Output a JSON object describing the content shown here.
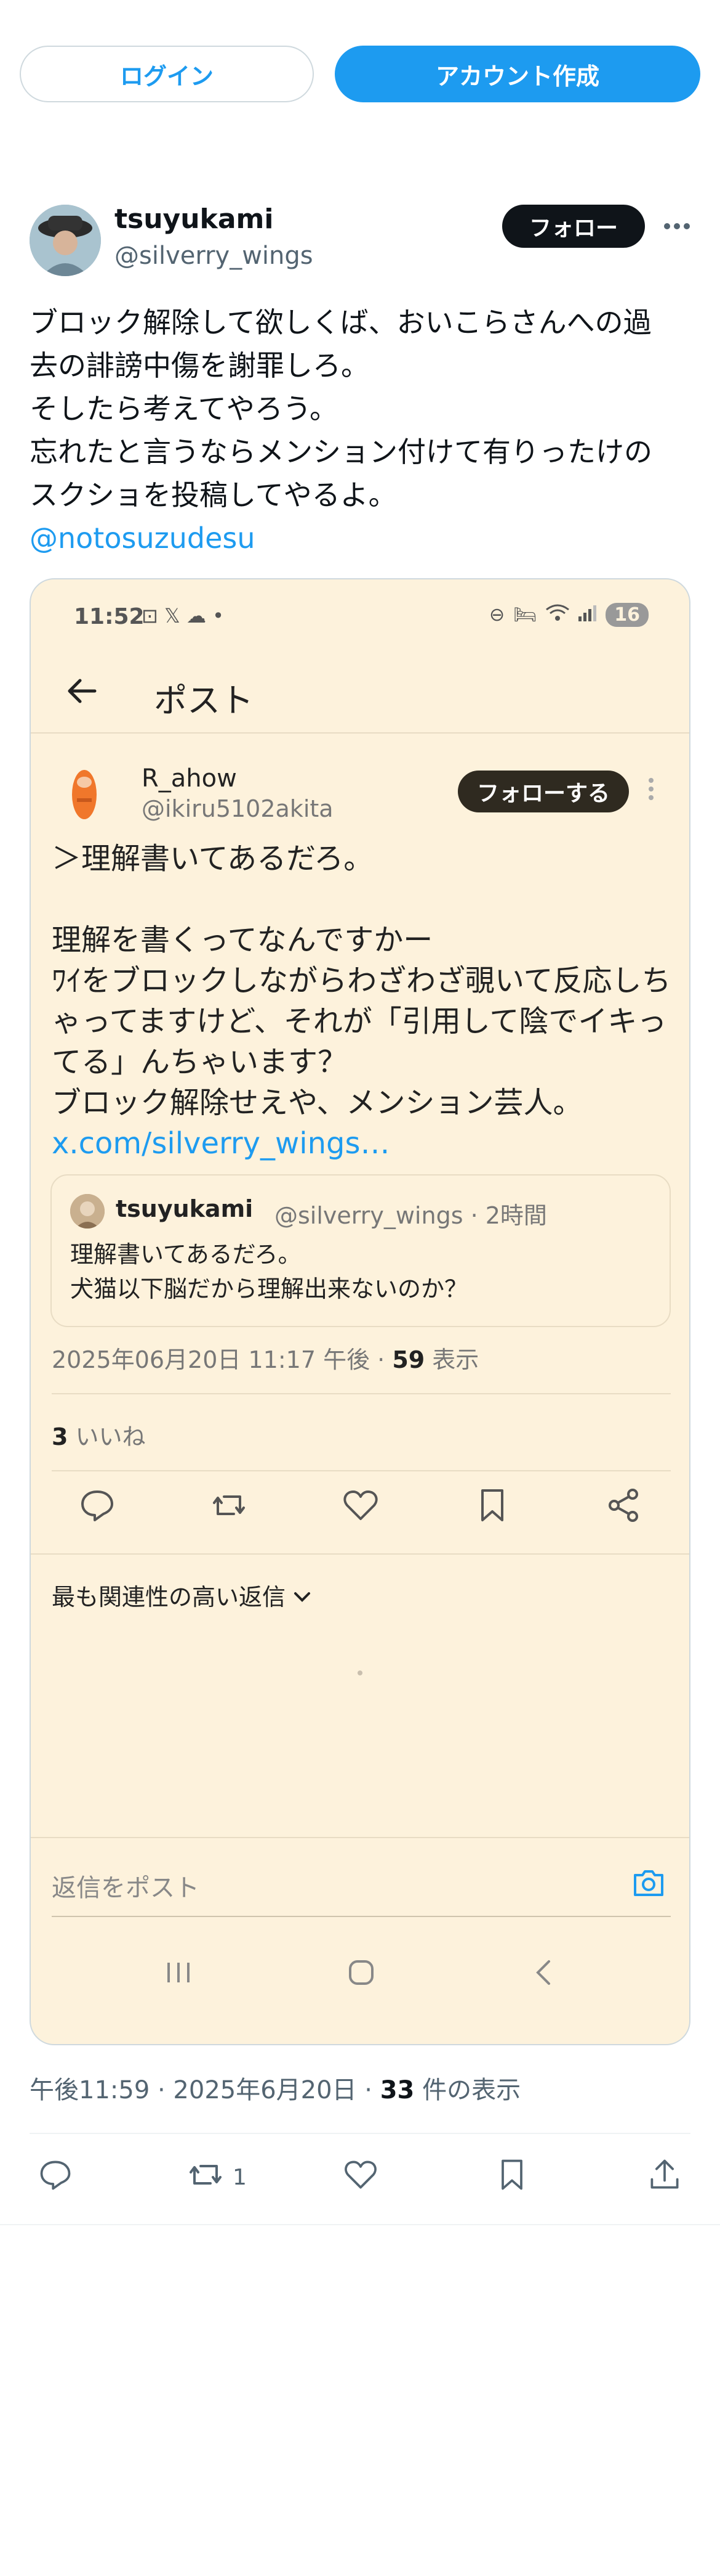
{
  "header": {
    "login_label": "ログイン",
    "signup_label": "アカウント作成"
  },
  "tweet": {
    "author_name": "tsuyukami",
    "author_handle": "@silverry_wings",
    "follow_label": "フォロー",
    "text_lines": [
      "ブロック解除して欲しくば、おいこらさんへの過",
      "去の誹謗中傷を謝罪しろ。",
      "そしたら考えてやろう。",
      "忘れたと言うならメンション付けて有りったけの",
      "スクショを投稿してやるよ。"
    ],
    "mention": "@notosuzudesu",
    "meta_time": "午後11:59 · 2025年6月20日 · ",
    "meta_views_count": "33",
    "meta_views_label": " 件の表示",
    "retweet_count": "1"
  },
  "screenshot": {
    "status_time": "11:52",
    "status_icons": "⊡ 𝕏 ☁ •",
    "battery": "16",
    "header_title": "ポスト",
    "author_name": "R_ahow",
    "author_handle": "@ikiru5102akita",
    "follow_label": "フォローする",
    "text_lines": [
      "＞理解書いてあるだろ。",
      "",
      "理解を書くってなんですかー",
      "ﾜｲをブロックしながらわざわざ覗いて反応しち",
      "ゃってますけど、それが「引用して陰でイキっ",
      "てる」んちゃいます？",
      "ブロック解除せえや、メンション芸人。"
    ],
    "link": "x.com/silverry_wings…",
    "quote": {
      "author_name": "tsuyukami",
      "author_handle_time": "@silverry_wings · 2時間",
      "text_lines": [
        "理解書いてあるだろ。",
        "犬猫以下脳だから理解出来ないのか？"
      ]
    },
    "timestamp": "2025年06月20日 11:17 午後 · ",
    "views_count": "59",
    "views_label": " 表示",
    "likes_count": "3",
    "likes_label": " いいね",
    "sort_label": "最も関連性の高い返信",
    "reply_placeholder": "返信をポスト"
  },
  "colors": {
    "accent": "#1d9bf0",
    "embed_bg": "#fdf2dc",
    "text_primary": "#0f1419",
    "text_secondary": "#536471"
  }
}
